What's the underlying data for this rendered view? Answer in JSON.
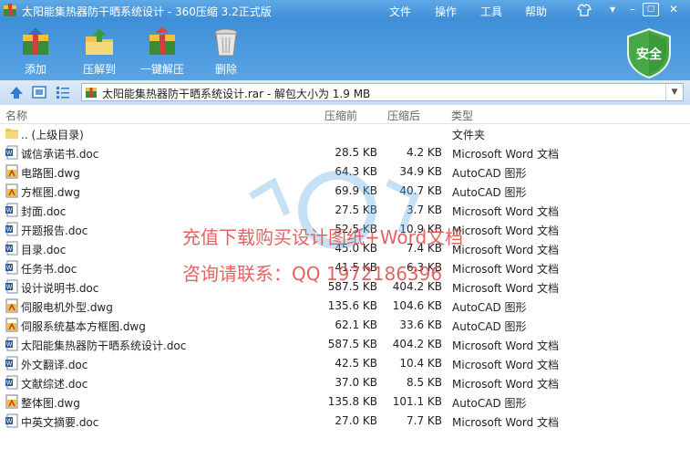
{
  "window": {
    "title": "太阳能集热器防干晒系统设计 - 360压缩 3.2正式版",
    "menu": [
      "文件",
      "操作",
      "工具",
      "帮助"
    ]
  },
  "toolbar": {
    "add": "添加",
    "extract_to": "压解到",
    "one_click_extract": "一键解压",
    "delete": "删除",
    "security_badge": "安全"
  },
  "address": {
    "path": "太阳能集热器防干晒系统设计.rar - 解包大小为 1.9 MB"
  },
  "columns": {
    "name": "名称",
    "compressed": "压缩前",
    "uncompressed": "压缩后",
    "type": "类型"
  },
  "files": [
    {
      "name": ".. (上级目录)",
      "compressed": "",
      "uncompressed": "",
      "type": "文件夹",
      "icon": "folder"
    },
    {
      "name": "诚信承诺书.doc",
      "compressed": "28.5 KB",
      "uncompressed": "4.2 KB",
      "type": "Microsoft Word 文档",
      "icon": "word"
    },
    {
      "name": "电路图.dwg",
      "compressed": "64.3 KB",
      "uncompressed": "34.9 KB",
      "type": "AutoCAD 图形",
      "icon": "cad"
    },
    {
      "name": "方框图.dwg",
      "compressed": "69.9 KB",
      "uncompressed": "40.7 KB",
      "type": "AutoCAD 图形",
      "icon": "cad"
    },
    {
      "name": "封面.doc",
      "compressed": "27.5 KB",
      "uncompressed": "3.7 KB",
      "type": "Microsoft Word 文档",
      "icon": "word"
    },
    {
      "name": "开题报告.doc",
      "compressed": "52.5 KB",
      "uncompressed": "10.9 KB",
      "type": "Microsoft Word 文档",
      "icon": "word"
    },
    {
      "name": "目录.doc",
      "compressed": "45.0 KB",
      "uncompressed": "7.4 KB",
      "type": "Microsoft Word 文档",
      "icon": "word"
    },
    {
      "name": "任务书.doc",
      "compressed": "41.5 KB",
      "uncompressed": "6.3 KB",
      "type": "Microsoft Word 文档",
      "icon": "word"
    },
    {
      "name": "设计说明书.doc",
      "compressed": "587.5 KB",
      "uncompressed": "404.2 KB",
      "type": "Microsoft Word 文档",
      "icon": "word"
    },
    {
      "name": "伺服电机外型.dwg",
      "compressed": "135.6 KB",
      "uncompressed": "104.6 KB",
      "type": "AutoCAD 图形",
      "icon": "cad"
    },
    {
      "name": "伺服系统基本方框图.dwg",
      "compressed": "62.1 KB",
      "uncompressed": "33.6 KB",
      "type": "AutoCAD 图形",
      "icon": "cad"
    },
    {
      "name": "太阳能集热器防干晒系统设计.doc",
      "compressed": "587.5 KB",
      "uncompressed": "404.2 KB",
      "type": "Microsoft Word 文档",
      "icon": "word"
    },
    {
      "name": "外文翻译.doc",
      "compressed": "42.5 KB",
      "uncompressed": "10.4 KB",
      "type": "Microsoft Word 文档",
      "icon": "word"
    },
    {
      "name": "文献综述.doc",
      "compressed": "37.0 KB",
      "uncompressed": "8.5 KB",
      "type": "Microsoft Word 文档",
      "icon": "word"
    },
    {
      "name": "整体图.dwg",
      "compressed": "135.8 KB",
      "uncompressed": "101.1 KB",
      "type": "AutoCAD 图形",
      "icon": "cad"
    },
    {
      "name": "中英文摘要.doc",
      "compressed": "27.0 KB",
      "uncompressed": "7.7 KB",
      "type": "Microsoft Word 文档",
      "icon": "word"
    }
  ],
  "watermark": {
    "line1": "充值下载购买设计图纸+Word文档",
    "line2": "咨询请联系：QQ 1972186396"
  },
  "colors": {
    "titlebar": "#4a98dc",
    "watermark": "#e05353",
    "shield": "#3a9a3a"
  }
}
